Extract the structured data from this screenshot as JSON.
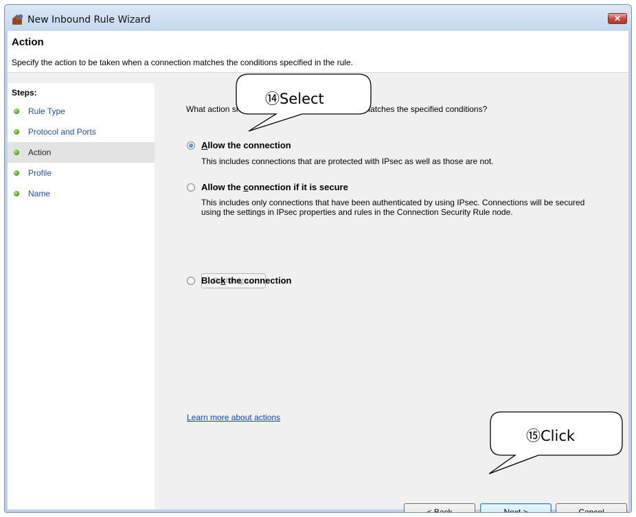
{
  "window": {
    "title": "New Inbound Rule Wizard",
    "close_symbol": "✕"
  },
  "header": {
    "title": "Action",
    "subtitle": "Specify the action to be taken when a connection matches the conditions specified in the rule."
  },
  "steps": {
    "title": "Steps:",
    "items": [
      {
        "label": "Rule Type",
        "current": false
      },
      {
        "label": "Protocol and Ports",
        "current": false
      },
      {
        "label": "Action",
        "current": true
      },
      {
        "label": "Profile",
        "current": false
      },
      {
        "label": "Name",
        "current": false
      }
    ]
  },
  "main": {
    "question": "What action should be taken when a connection matches the specified conditions?",
    "options": [
      {
        "label_pre": "",
        "label_key": "A",
        "label_post": "llow the connection",
        "selected": true,
        "description": "This includes connections that are protected with IPsec as well as those are not."
      },
      {
        "label_pre": "Allow the ",
        "label_key": "c",
        "label_post": "onnection if it is secure",
        "selected": false,
        "description": "This includes only connections that have been authenticated by using IPsec.  Connections will be secured using the settings in IPsec properties and rules in the Connection Security Rule node."
      },
      {
        "label_pre": "Bloc",
        "label_key": "k",
        "label_post": " the connection",
        "selected": false,
        "description": ""
      }
    ],
    "customize": {
      "pre": "Customi",
      "key": "z",
      "post": "e..."
    },
    "learn_more": "Learn more about actions"
  },
  "buttons": {
    "back": {
      "pre": "< ",
      "key": "B",
      "post": "ack"
    },
    "next": "Next >",
    "cancel": "Cancel"
  },
  "callouts": {
    "select": "⑭Select",
    "click": "⑮Click"
  }
}
